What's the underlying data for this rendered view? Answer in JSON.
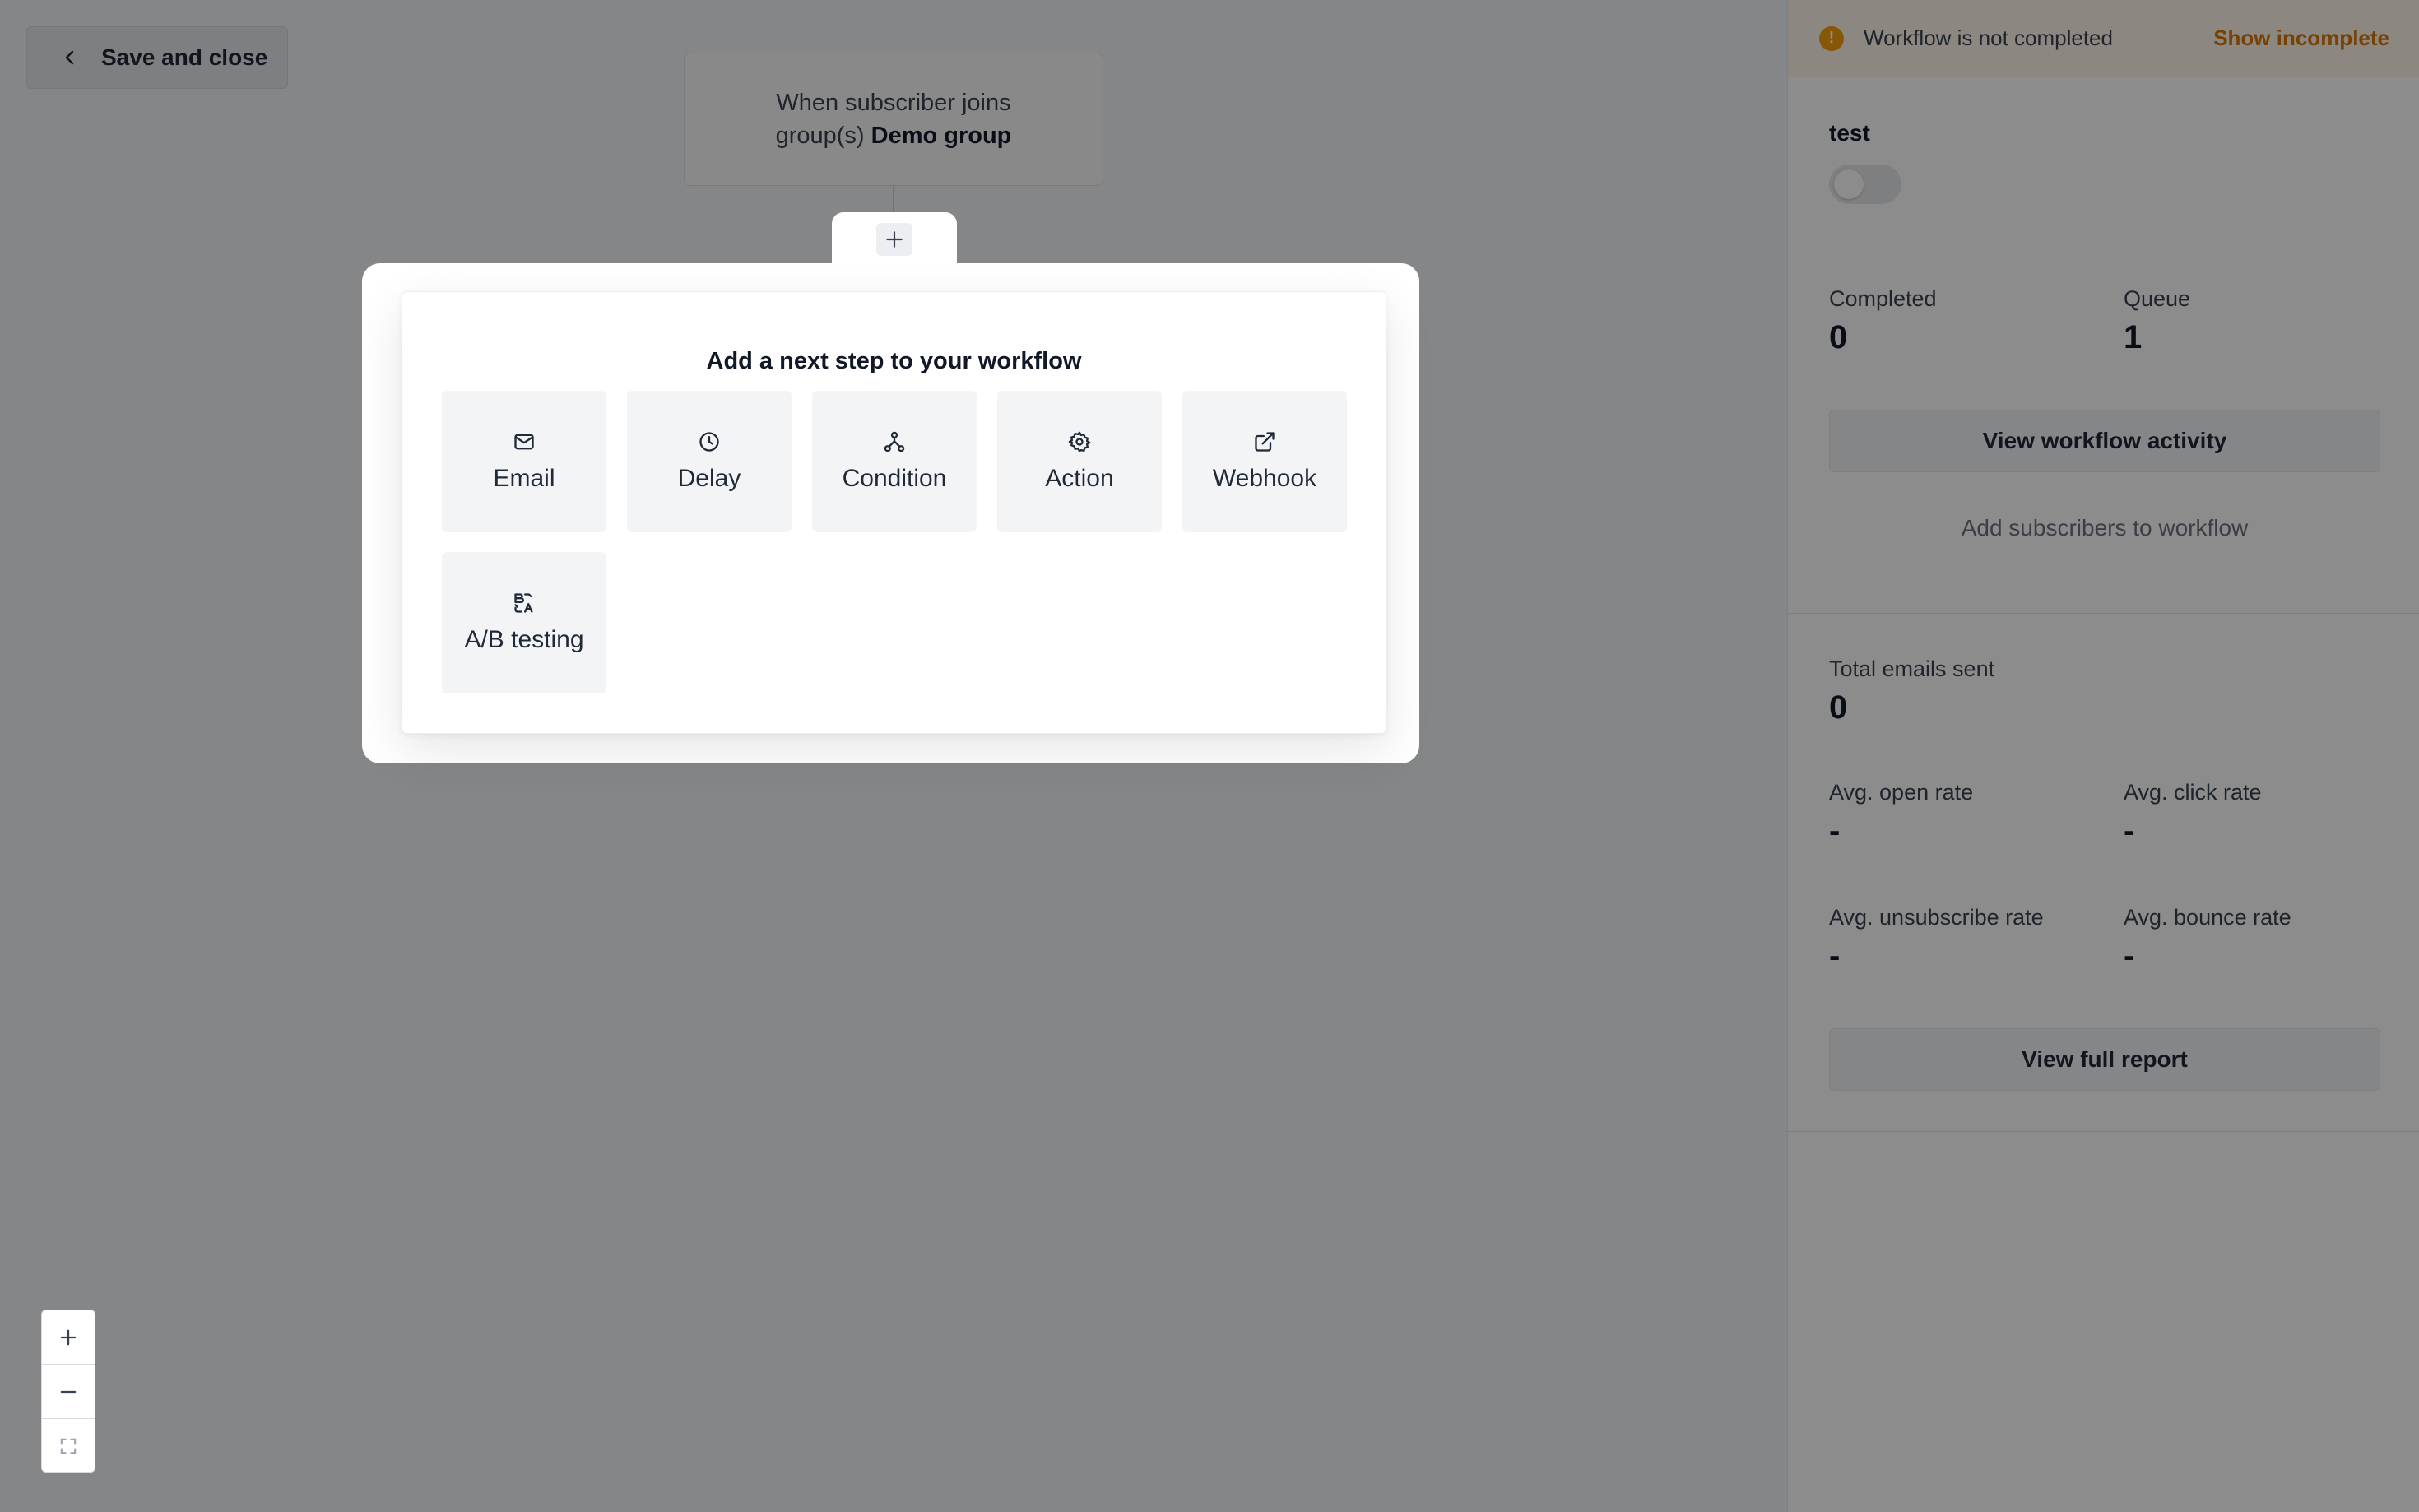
{
  "canvas": {
    "save_close_label": "Save and close",
    "trigger": {
      "line1": "When subscriber joins",
      "line2_prefix": "group(s) ",
      "group_name": "Demo group"
    }
  },
  "modal": {
    "title": "Add a next step to your workflow",
    "steps": [
      {
        "label": "Email",
        "icon": "mail-icon"
      },
      {
        "label": "Delay",
        "icon": "clock-icon"
      },
      {
        "label": "Condition",
        "icon": "branch-icon"
      },
      {
        "label": "Action",
        "icon": "gear-icon"
      },
      {
        "label": "Webhook",
        "icon": "external-link-icon"
      },
      {
        "label": "A/B testing",
        "icon": "ab-test-icon"
      }
    ]
  },
  "zoom": {
    "icons": [
      "plus-icon",
      "minus-icon",
      "fit-screen-icon"
    ]
  },
  "sidebar": {
    "banner": {
      "text": "Workflow is not completed",
      "link": "Show incomplete",
      "icon": "warning-icon"
    },
    "workflow_name": "test",
    "toggle_on": false,
    "completed_label": "Completed",
    "completed_value": "0",
    "queue_label": "Queue",
    "queue_value": "1",
    "view_activity": "View workflow activity",
    "add_subscribers": "Add subscribers to workflow",
    "total_sent_label": "Total emails sent",
    "total_sent_value": "0",
    "open_rate_label": "Avg. open rate",
    "open_rate_value": "-",
    "click_rate_label": "Avg. click rate",
    "click_rate_value": "-",
    "unsub_rate_label": "Avg. unsubscribe rate",
    "unsub_rate_value": "-",
    "bounce_rate_label": "Avg. bounce rate",
    "bounce_rate_value": "-",
    "view_report": "View full report"
  },
  "colors": {
    "accent_warning": "#d97706",
    "banner_bg": "#fff8eb",
    "overlay": "rgba(0,0,0,0.45)"
  }
}
